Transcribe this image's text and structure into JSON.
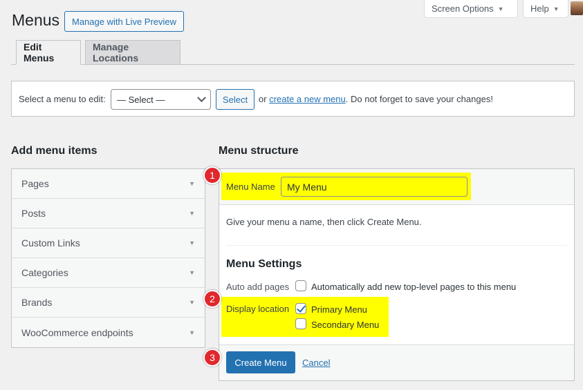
{
  "screen_meta": {
    "screen_options_label": "Screen Options",
    "help_label": "Help"
  },
  "header": {
    "title": "Menus",
    "live_preview_label": "Manage with Live Preview"
  },
  "tabs": [
    {
      "label": "Edit Menus"
    },
    {
      "label": "Manage Locations"
    }
  ],
  "select_menu": {
    "label": "Select a menu to edit:",
    "selected": "— Select —",
    "button_label": "Select",
    "msg_prefix": "or",
    "create_link": "create a new menu",
    "msg_suffix": ". Do not forget to save your changes!"
  },
  "add_items": {
    "title": "Add menu items",
    "items": [
      {
        "label": "Pages"
      },
      {
        "label": "Posts"
      },
      {
        "label": "Custom Links"
      },
      {
        "label": "Categories"
      },
      {
        "label": "Brands"
      },
      {
        "label": "WooCommerce endpoints"
      }
    ]
  },
  "structure": {
    "title": "Menu structure",
    "menu_name_label": "Menu Name",
    "menu_name_value": "My Menu",
    "hint": "Give your menu a name, then click Create Menu.",
    "settings_title": "Menu Settings",
    "auto_add_label": "Auto add pages",
    "auto_add_option": "Automatically add new top-level pages to this menu",
    "display_location_label": "Display location",
    "primary_label": "Primary Menu",
    "secondary_label": "Secondary Menu",
    "create_button": "Create Menu",
    "cancel_link": "Cancel"
  },
  "markers": [
    "1",
    "2",
    "3"
  ],
  "colors": {
    "accent": "#2271b1",
    "highlight": "#ffff00",
    "marker": "#e0282d"
  }
}
